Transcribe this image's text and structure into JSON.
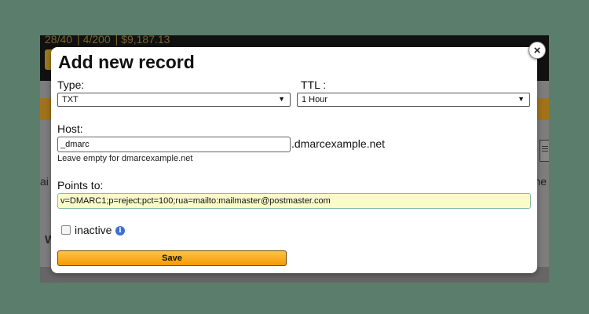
{
  "background": {
    "stats": [
      "28/40",
      "4/200",
      "$9,187.13"
    ],
    "left_text": "ai",
    "right_text": "ne",
    "row_label": "W"
  },
  "modal": {
    "title": "Add new record",
    "type_label": "Type:",
    "type_value": "TXT",
    "ttl_label": "TTL :",
    "ttl_value": "1 Hour",
    "host_label": "Host:",
    "host_value": "_dmarc",
    "host_suffix": ".dmarcexample.net",
    "host_hint": "Leave empty for dmarcexample.net",
    "points_label": "Points to:",
    "points_value": "v=DMARC1;p=reject;pct=100;rua=mailto:mailmaster@postmaster.com",
    "inactive_label": "inactive",
    "save_label": "Save"
  },
  "icons": {
    "close": "close-icon",
    "info": "info-icon",
    "chevron": "chevron-down-icon"
  }
}
